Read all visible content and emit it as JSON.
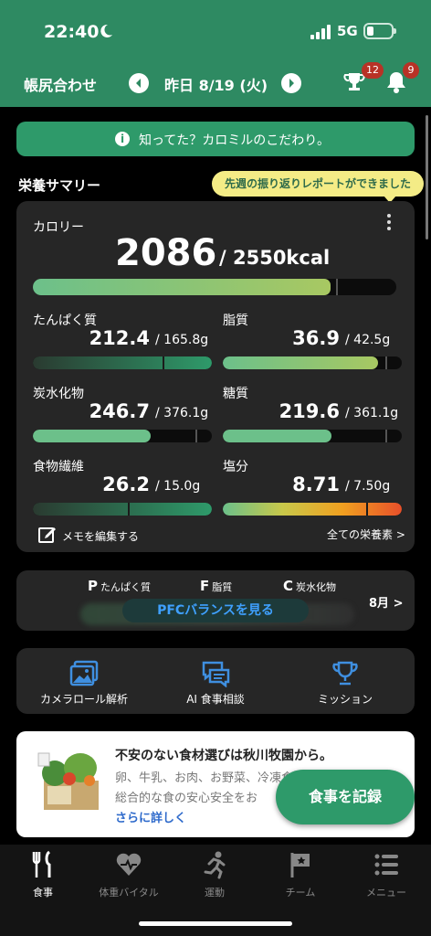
{
  "status": {
    "time": "22:40",
    "network": "5G"
  },
  "header": {
    "title": "帳尻合わせ",
    "date": "昨日 8/19 (火)",
    "trophy_badge": "12",
    "bell_badge": "9"
  },
  "info_banner": "知ってた？カロミルのこだわり。",
  "section_title": "栄養サマリー",
  "tooltip": "先週の振り返りレポートができました",
  "calorie": {
    "label": "カロリー",
    "value": "2086",
    "target": "/ 2550kcal",
    "progress": 0.818
  },
  "nutrients": [
    {
      "name": "たんぱく質",
      "value": "212.4",
      "target": "/ 165.8g",
      "progress": 1.28
    },
    {
      "name": "脂質",
      "value": "36.9",
      "target": "/ 42.5g",
      "progress": 0.868
    },
    {
      "name": "炭水化物",
      "value": "246.7",
      "target": "/ 376.1g",
      "progress": 0.656
    },
    {
      "name": "糖質",
      "value": "219.6",
      "target": "/ 361.1g",
      "progress": 0.608
    },
    {
      "name": "食物繊維",
      "value": "26.2",
      "target": "/ 15.0g",
      "progress": 1.75
    },
    {
      "name": "塩分",
      "value": "8.71",
      "target": "/ 7.50g",
      "progress": 1.16
    }
  ],
  "memo_label": "メモを編集する",
  "all_nutrients_label": "全ての栄養素 >",
  "pfc": {
    "p_letter": "P",
    "p_label": "たんぱく質",
    "f_letter": "F",
    "f_label": "脂質",
    "c_letter": "C",
    "c_label": "炭水化物",
    "button": "PFCバランスを見る",
    "month": "8月 >"
  },
  "actions": [
    {
      "label": "カメラロール解析",
      "icon": "photo-gallery-icon"
    },
    {
      "label": "AI 食事相談",
      "icon": "chat-icon"
    },
    {
      "label": "ミッション",
      "icon": "trophy-icon"
    }
  ],
  "ad": {
    "title": "不安のない食材選びは秋川牧園から。",
    "line1": "卵、牛乳、お肉、お野菜、冷凍食品まで",
    "line2": "総合的な食の安心安全をお",
    "more": "さらに詳しく"
  },
  "fab_label": "食事を記録",
  "tabs": [
    {
      "label": "食事",
      "active": true
    },
    {
      "label": "体重バイタル",
      "active": false
    },
    {
      "label": "運動",
      "active": false
    },
    {
      "label": "チーム",
      "active": false
    },
    {
      "label": "メニュー",
      "active": false
    }
  ],
  "colors": {
    "brand_green": "#2e8a62",
    "accent_green": "#2e9a6a",
    "badge_red": "#b83226",
    "link_blue": "#3fa0ff"
  }
}
